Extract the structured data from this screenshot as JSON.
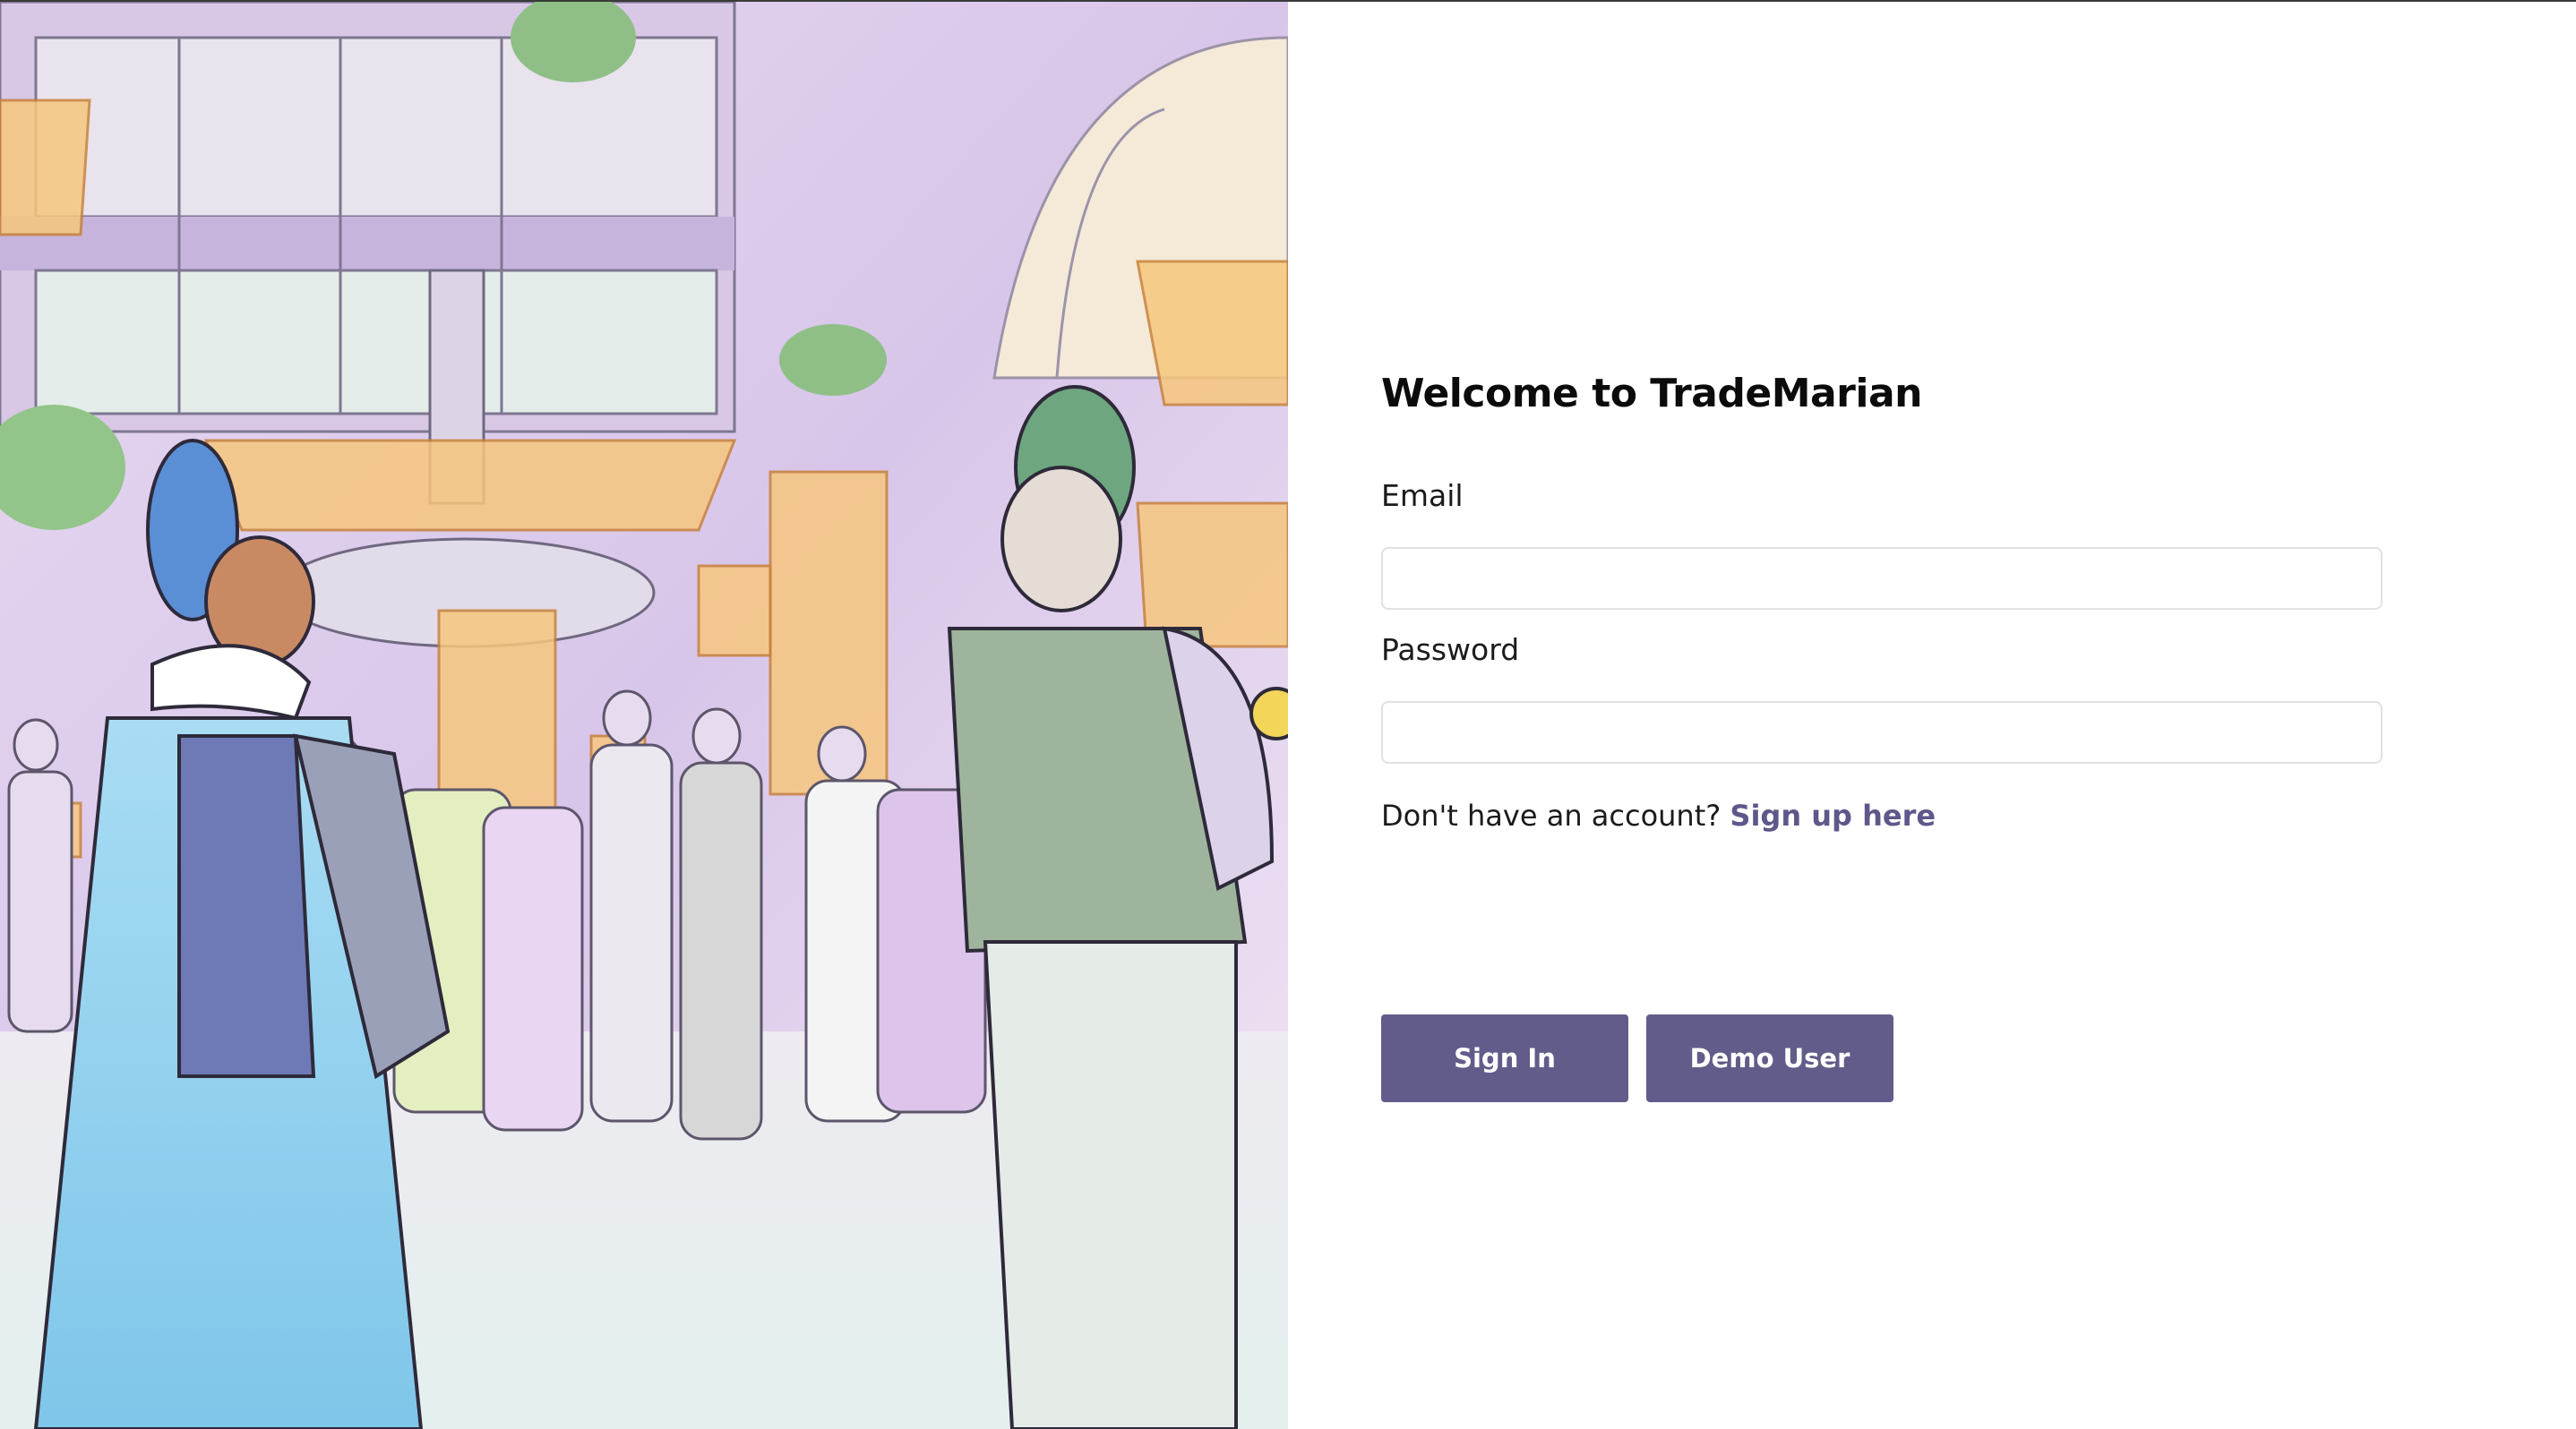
{
  "illustration": {
    "description_icon": "futuristic-trading-plaza-illustration"
  },
  "login": {
    "title": "Welcome to TradeMarian",
    "email_label": "Email",
    "email_value": "",
    "password_label": "Password",
    "password_value": "",
    "signup_prompt": "Don't have an account?",
    "signup_link": "Sign up here",
    "signin_button": "Sign In",
    "demo_button": "Demo User"
  },
  "colors": {
    "accent": "#625c8a",
    "link": "#5e588a",
    "input_border": "#e1e1e6"
  }
}
